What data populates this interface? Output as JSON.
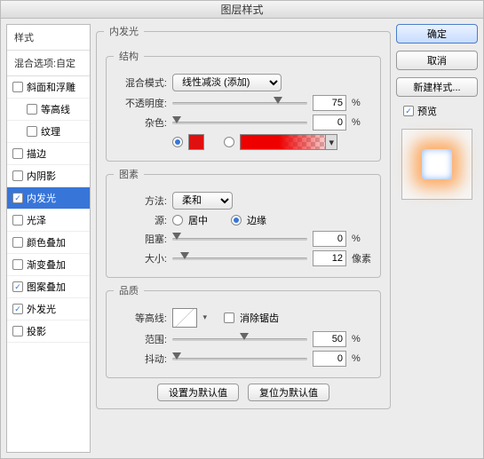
{
  "title": "图层样式",
  "left": {
    "header": "样式",
    "sub": "混合选项:自定",
    "items": [
      {
        "label": "斜面和浮雕",
        "checked": false,
        "indent": false
      },
      {
        "label": "等高线",
        "checked": false,
        "indent": true
      },
      {
        "label": "纹理",
        "checked": false,
        "indent": true
      },
      {
        "label": "描边",
        "checked": false,
        "indent": false
      },
      {
        "label": "内阴影",
        "checked": false,
        "indent": false
      },
      {
        "label": "内发光",
        "checked": true,
        "indent": false,
        "selected": true
      },
      {
        "label": "光泽",
        "checked": false,
        "indent": false
      },
      {
        "label": "颜色叠加",
        "checked": false,
        "indent": false
      },
      {
        "label": "渐变叠加",
        "checked": false,
        "indent": false
      },
      {
        "label": "图案叠加",
        "checked": true,
        "indent": false
      },
      {
        "label": "外发光",
        "checked": true,
        "indent": false
      },
      {
        "label": "投影",
        "checked": false,
        "indent": false
      }
    ]
  },
  "panel": {
    "title": "内发光",
    "structure": {
      "legend": "结构",
      "blend_label": "混合模式:",
      "blend_value": "线性减淡 (添加)",
      "opacity_label": "不透明度:",
      "opacity_value": "75",
      "noise_label": "杂色:",
      "noise_value": "0",
      "pct": "%",
      "solid_color": "#e01010",
      "color_mode": "solid"
    },
    "elements": {
      "legend": "图素",
      "method_label": "方法:",
      "method_value": "柔和",
      "source_label": "源:",
      "source_center": "居中",
      "source_edge": "边缘",
      "source_selected": "edge",
      "choke_label": "阻塞:",
      "choke_value": "0",
      "size_label": "大小:",
      "size_value": "12",
      "pct": "%",
      "px": "像素"
    },
    "quality": {
      "legend": "品质",
      "contour_label": "等高线:",
      "antialias_label": "消除锯齿",
      "antialias_checked": false,
      "range_label": "范围:",
      "range_value": "50",
      "jitter_label": "抖动:",
      "jitter_value": "0",
      "pct": "%"
    },
    "defaults": {
      "set": "设置为默认值",
      "reset": "复位为默认值"
    }
  },
  "right": {
    "ok": "确定",
    "cancel": "取消",
    "new_style": "新建样式...",
    "preview": "预览",
    "preview_checked": true
  }
}
